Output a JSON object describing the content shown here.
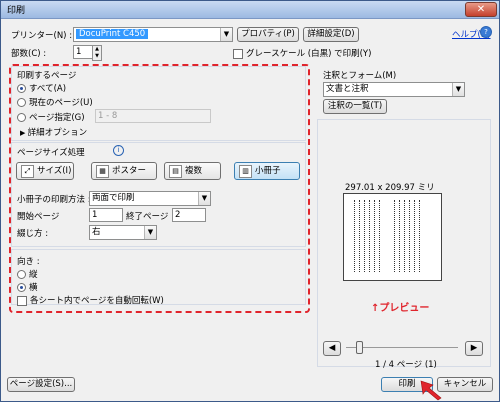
{
  "window": {
    "title": "印刷"
  },
  "printer": {
    "label": "プリンター(N) :",
    "value": "DocuPrint C450",
    "properties_label": "プロパティ(P)",
    "advanced_label": "詳細設定(D)",
    "help_label": "ヘルプ(H)"
  },
  "copies": {
    "label": "部数(C) :",
    "value": "1"
  },
  "grayscale": {
    "label": "グレースケール (白黒) で印刷(Y)"
  },
  "pages_section": {
    "title": "印刷するページ",
    "options": [
      "すべて(A)",
      "現在のページ(U)",
      "ページ指定(G)"
    ],
    "range_placeholder": "1 - 8",
    "more_options": "詳細オプション"
  },
  "page_sizing": {
    "title": "ページサイズ処理",
    "info_icon": "i",
    "tiles": [
      "サイズ(I)",
      "ポスター",
      "複数",
      "小冊子"
    ],
    "booklet_method_label": "小冊子の印刷方法 :",
    "booklet_method_value": "両面で印刷",
    "start_page_label": "開始ページ",
    "start_page_value": "1",
    "end_page_label": "終了ページ",
    "end_page_value": "2",
    "binding_label": "綴じ方 :",
    "binding_value": "右"
  },
  "orientation": {
    "title": "向き :",
    "options": [
      "縦",
      "横"
    ],
    "auto_rotate": "各シート内でページを自動回転(W)"
  },
  "annotations": {
    "title": "注釈とフォーム(M)",
    "value": "文書と注釈",
    "summary_button": "注釈の一覧(T)"
  },
  "preview": {
    "size": "297.01 x 209.97 ミリ",
    "annotation": "↑プレビュー",
    "page_counter": "1 / 4 ページ (1)"
  },
  "footer": {
    "page_setup": "ページ設定(S)...",
    "print": "印刷",
    "cancel": "キャンセル"
  }
}
